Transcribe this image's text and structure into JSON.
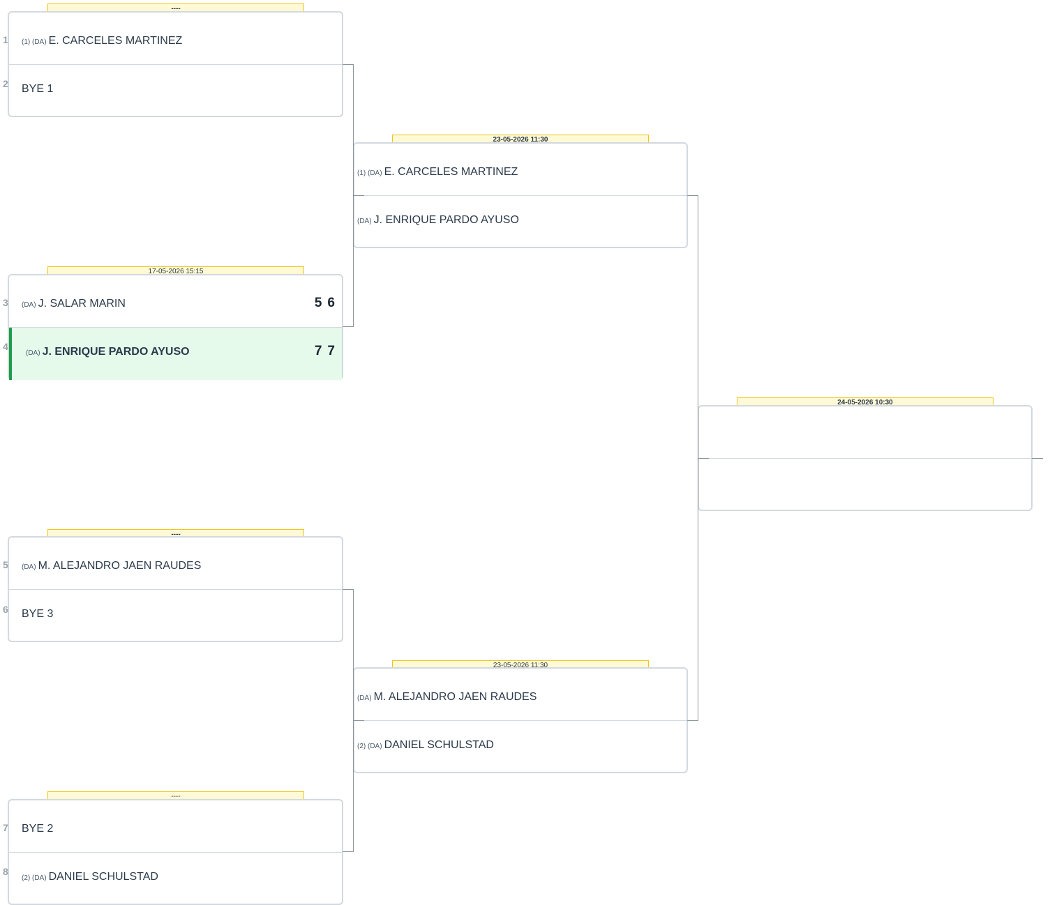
{
  "round1": {
    "matches": [
      {
        "date": "----",
        "date_bold": true,
        "top": {
          "seed": "(1) (DA)",
          "name": "E. CARCELES MARTINEZ",
          "pos": "1"
        },
        "bottom": {
          "seed": "",
          "name": "BYE 1",
          "pos": "2"
        }
      },
      {
        "date": "17-05-2026 15:15",
        "date_bold": false,
        "top": {
          "seed": "(DA)",
          "name": "J. SALAR MARIN",
          "pos": "3",
          "scores": [
            "5",
            "6"
          ]
        },
        "bottom": {
          "seed": "(DA)",
          "name": "J. ENRIQUE PARDO AYUSO",
          "pos": "4",
          "scores": [
            "7",
            "7"
          ],
          "winner": true
        }
      },
      {
        "date": "----",
        "date_bold": true,
        "top": {
          "seed": "(DA)",
          "name": "M. ALEJANDRO JAEN RAUDES",
          "pos": "5"
        },
        "bottom": {
          "seed": "",
          "name": "BYE 3",
          "pos": "6"
        }
      },
      {
        "date": "----",
        "date_bold": false,
        "top": {
          "seed": "",
          "name": "BYE 2",
          "pos": "7"
        },
        "bottom": {
          "seed": "(2) (DA)",
          "name": "DANIEL SCHULSTAD",
          "pos": "8"
        }
      }
    ]
  },
  "round2": {
    "matches": [
      {
        "date": "23-05-2026 11:30",
        "date_bold": true,
        "top": {
          "seed": "(1) (DA)",
          "name": "E. CARCELES MARTINEZ"
        },
        "bottom": {
          "seed": "(DA)",
          "name": "J. ENRIQUE PARDO AYUSO"
        }
      },
      {
        "date": "23-05-2026 11:30",
        "date_bold": false,
        "top": {
          "seed": "(DA)",
          "name": "M. ALEJANDRO JAEN RAUDES"
        },
        "bottom": {
          "seed": "(2) (DA)",
          "name": "DANIEL SCHULSTAD"
        }
      }
    ]
  },
  "round3": {
    "matches": [
      {
        "date": "24-05-2026 10:30",
        "date_bold": true,
        "top": {
          "seed": "",
          "name": ""
        },
        "bottom": {
          "seed": "",
          "name": ""
        }
      }
    ]
  }
}
